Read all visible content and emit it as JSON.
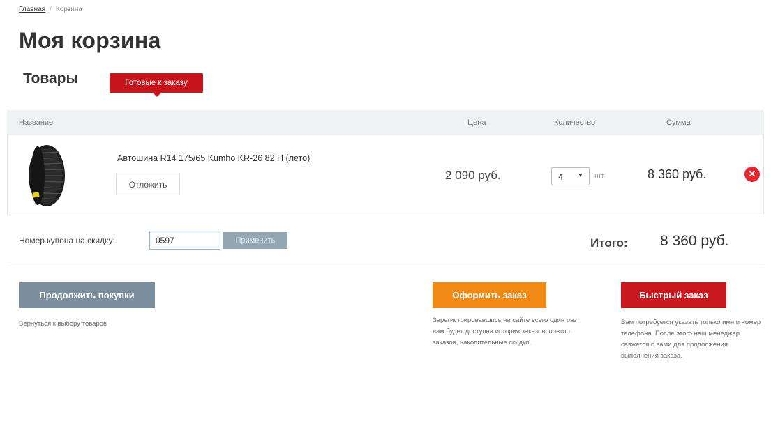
{
  "breadcrumb": {
    "home": "Главная",
    "current": "Корзина"
  },
  "page_title": "Моя корзина",
  "section_title": "Товары",
  "tab_ready": "Готовые к заказу",
  "table": {
    "col_name": "Название",
    "col_price": "Цена",
    "col_qty": "Количество",
    "col_sum": "Сумма"
  },
  "item": {
    "icon": "tire-image",
    "name": "Автошина R14 175/65 Kumho KR-26 82 H (лето)",
    "defer_label": "Отложить",
    "price": "2 090 руб.",
    "quantity": "4",
    "unit": "шт.",
    "sum": "8 360 руб.",
    "remove_icon": "close-icon"
  },
  "coupon": {
    "label": "Номер купона на скидку:",
    "value": "0597",
    "apply_label": "Применить"
  },
  "total": {
    "label": "Итого:",
    "value": "8 360 руб."
  },
  "actions": {
    "continue_label": "Продолжить покупки",
    "continue_note": "Вернуться к выбору товаров",
    "checkout_label": "Оформить заказ",
    "checkout_note": "Зарегистрировавшись на сайте всего один раз вам будет доступна история заказов, повтор заказов, накопительные скидки.",
    "quick_label": "Быстрый заказ",
    "quick_note": "Вам потребуется указать только имя и номер телефона. После этого наш менеджер свяжется с вами для продолжения выполнения заказа."
  },
  "colors": {
    "brand_red": "#c8151b",
    "checkout_orange": "#f08a14",
    "continue_gray": "#7a8e9d",
    "header_bg": "#eef2f3"
  }
}
